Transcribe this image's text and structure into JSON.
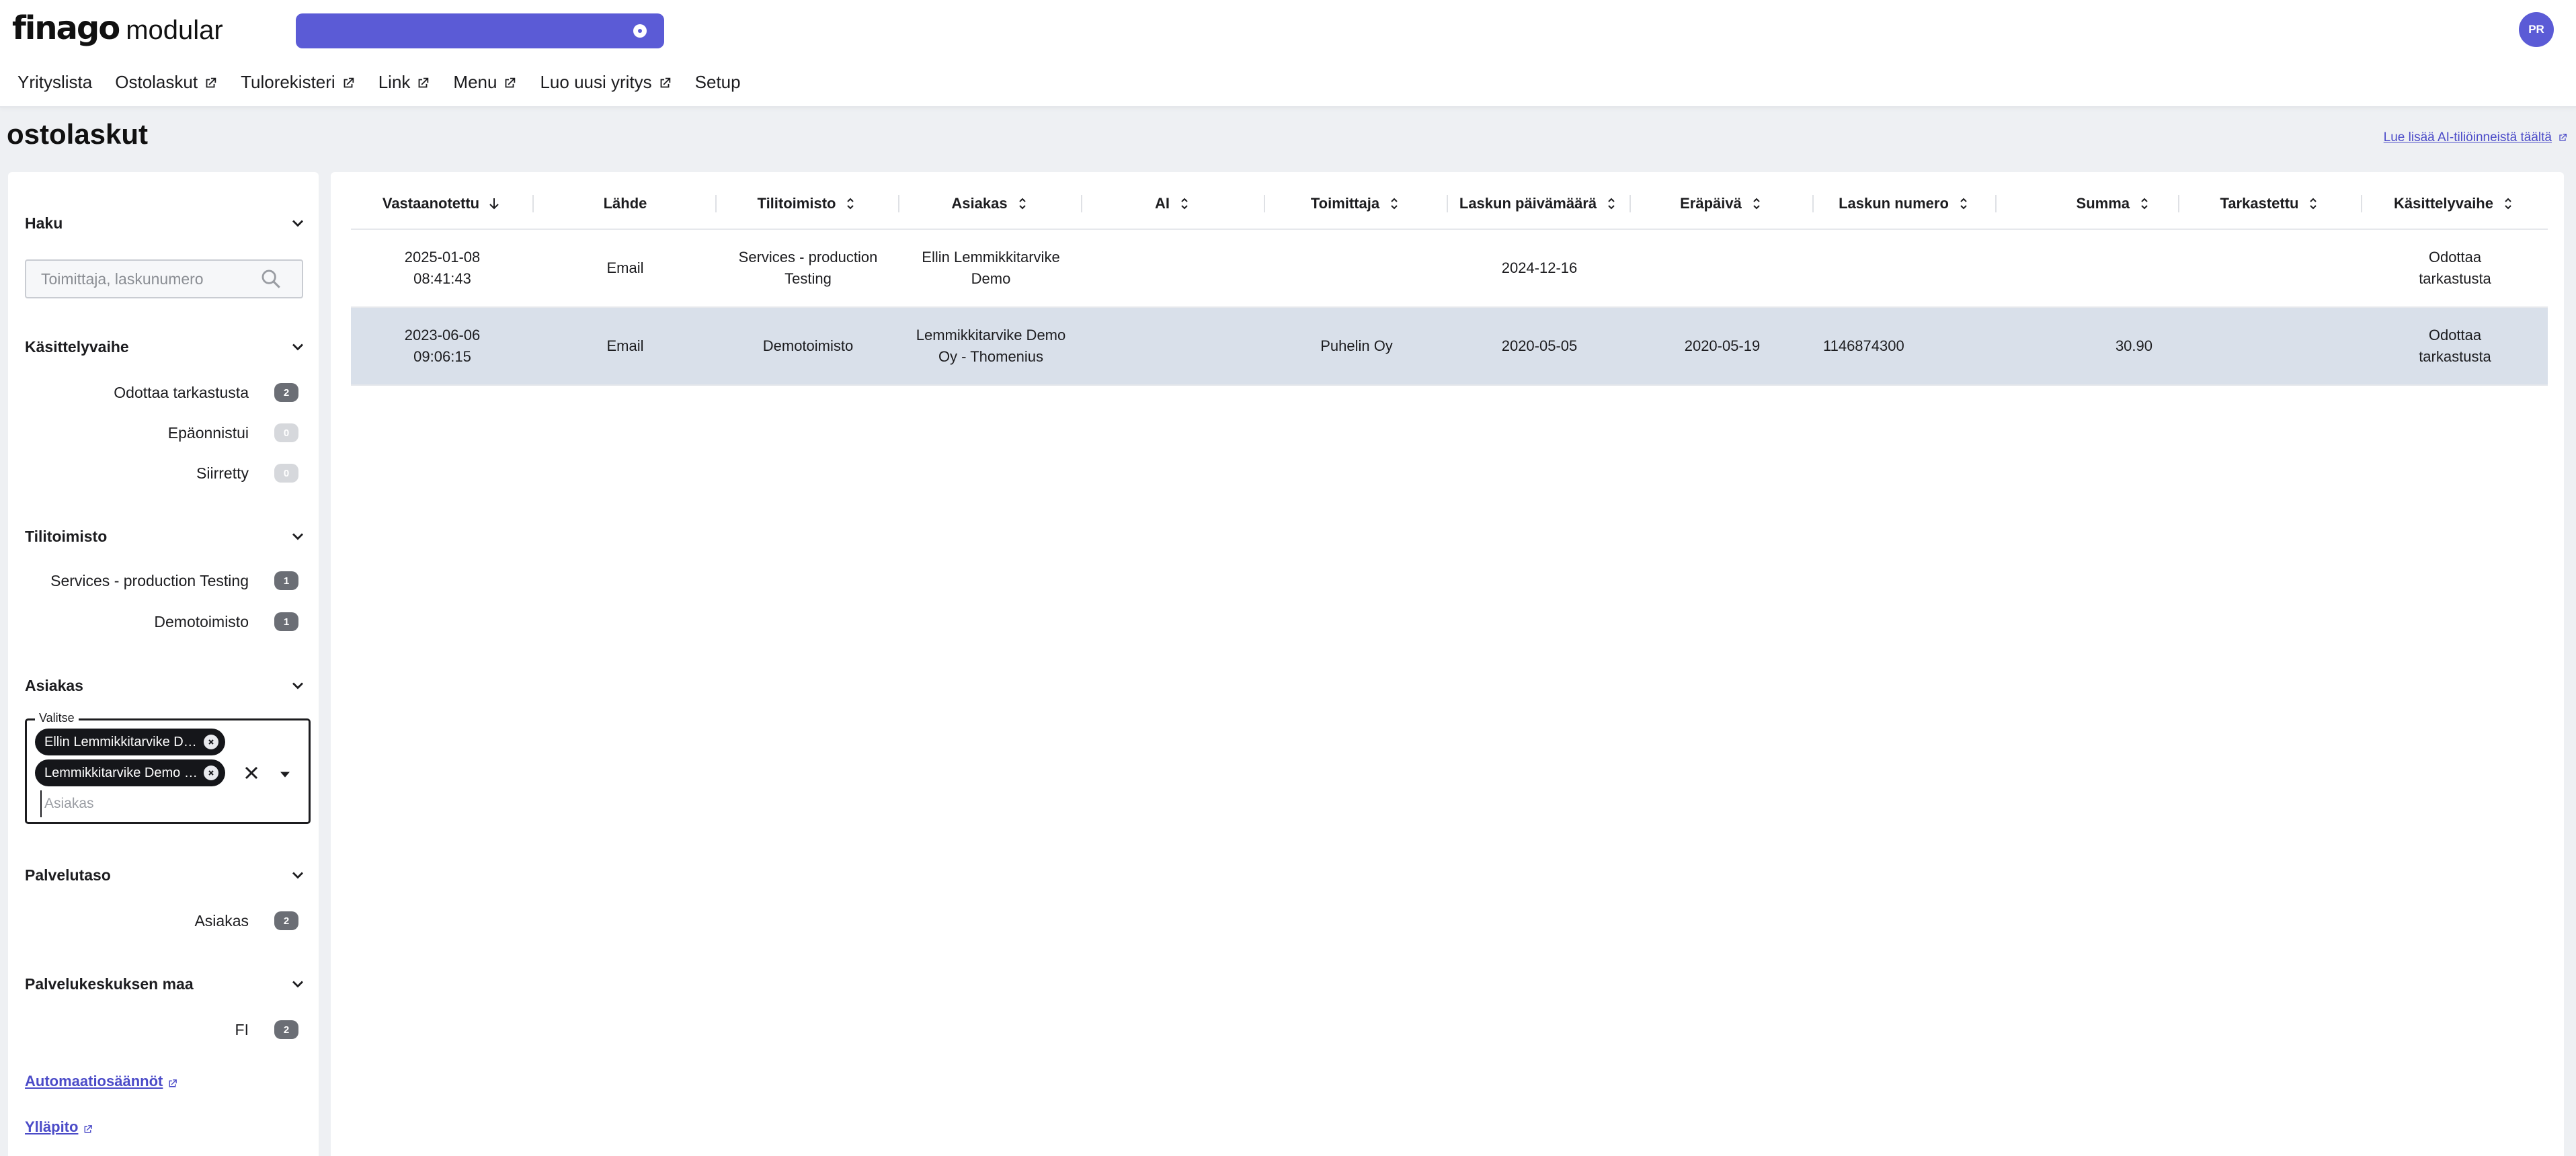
{
  "header": {
    "logo_brand": "finago",
    "logo_product": "modular",
    "avatar_initials": "PR",
    "accent_color": "#5b5bd6"
  },
  "nav": {
    "items": [
      {
        "label": "Yrityslista",
        "external": false
      },
      {
        "label": "Ostolaskut",
        "external": true
      },
      {
        "label": "Tulorekisteri",
        "external": true
      },
      {
        "label": "Link",
        "external": true
      },
      {
        "label": "Menu",
        "external": true
      },
      {
        "label": "Luo uusi yritys",
        "external": true
      },
      {
        "label": "Setup",
        "external": false
      }
    ]
  },
  "page": {
    "title": "ostolaskut",
    "ai_link": "Lue lisää AI-tiliöinneistä täältä"
  },
  "sidebar": {
    "search": {
      "title": "Haku",
      "placeholder": "Toimittaja, laskunumero"
    },
    "status": {
      "title": "Käsittelyvaihe",
      "items": [
        {
          "label": "Odottaa tarkastusta",
          "count": "2"
        },
        {
          "label": "Epäonnistui",
          "count": "0"
        },
        {
          "label": "Siirretty",
          "count": "0"
        }
      ]
    },
    "office": {
      "title": "Tilitoimisto",
      "items": [
        {
          "label": "Services - production Testing",
          "count": "1"
        },
        {
          "label": "Demotoimisto",
          "count": "1"
        }
      ]
    },
    "customer": {
      "title": "Asiakas",
      "legend": "Valitse",
      "chips": [
        "Ellin Lemmikkitarvike Demo",
        "Lemmikkitarvike Demo Oy - Thomenius"
      ],
      "placeholder": "Asiakas"
    },
    "service_level": {
      "title": "Palvelutaso",
      "items": [
        {
          "label": "Asiakas",
          "count": "2"
        }
      ]
    },
    "country": {
      "title": "Palvelukeskuksen maa",
      "items": [
        {
          "label": "FI",
          "count": "2"
        }
      ]
    },
    "links": {
      "automation": "Automaatiosäännöt",
      "admin": "Ylläpito"
    }
  },
  "table": {
    "columns": [
      {
        "label": "Vastaanotettu",
        "sort": "desc"
      },
      {
        "label": "Lähde",
        "sort": "none"
      },
      {
        "label": "Tilitoimisto",
        "sort": "both"
      },
      {
        "label": "Asiakas",
        "sort": "both"
      },
      {
        "label": "AI",
        "sort": "both"
      },
      {
        "label": "Toimittaja",
        "sort": "both"
      },
      {
        "label": "Laskun päivämäärä",
        "sort": "both"
      },
      {
        "label": "Eräpäivä",
        "sort": "both"
      },
      {
        "label": "Laskun numero",
        "sort": "both"
      },
      {
        "label": "Summa",
        "sort": "both"
      },
      {
        "label": "Tarkastettu",
        "sort": "both"
      },
      {
        "label": "Käsittelyvaihe",
        "sort": "both"
      }
    ],
    "rows": [
      {
        "received": "2025-01-08\n08:41:43",
        "source": "Email",
        "office": "Services - production\nTesting",
        "customer": "Ellin Lemmikkitarvike\nDemo",
        "ai": "",
        "supplier": "",
        "invoice_date": "2024-12-16",
        "due_date": "",
        "invoice_number": "",
        "amount": "",
        "checked": "",
        "status": "Odottaa\ntarkastusta",
        "selected": false
      },
      {
        "received": "2023-06-06\n09:06:15",
        "source": "Email",
        "office": "Demotoimisto",
        "customer": "Lemmikkitarvike Demo\nOy - Thomenius",
        "ai": "",
        "supplier": "Puhelin Oy",
        "invoice_date": "2020-05-05",
        "due_date": "2020-05-19",
        "invoice_number": "1146874300",
        "amount": "30.90",
        "checked": "",
        "status": "Odottaa\ntarkastusta",
        "selected": true
      }
    ]
  }
}
